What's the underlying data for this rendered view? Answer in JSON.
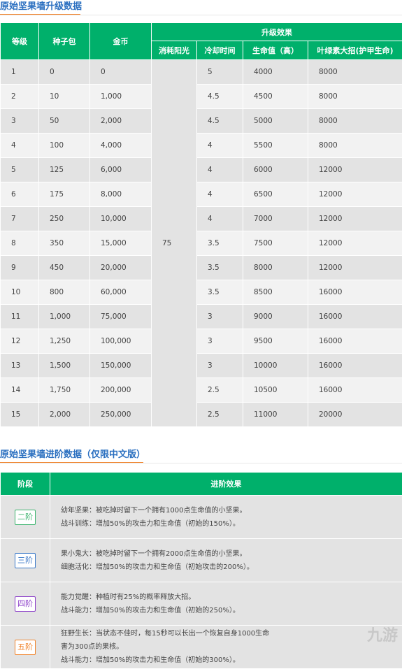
{
  "upgrade_section": {
    "title": "原始坚果墙升级数据",
    "headers": {
      "level": "等级",
      "seed_pack": "种子包",
      "gold": "金币",
      "effect_group": "升级效果",
      "sun_cost": "消耗阳光",
      "cooldown": "冷却时间",
      "health": "生命值（高）",
      "plant_food": "叶绿素大招(护甲生命)"
    },
    "sun_cost_value": "75",
    "rows": [
      {
        "level": "1",
        "seed": "0",
        "gold": "0",
        "cooldown": "5",
        "health": "4000",
        "pf": "8000"
      },
      {
        "level": "2",
        "seed": "10",
        "gold": "1,000",
        "cooldown": "4.5",
        "health": "4500",
        "pf": "8000"
      },
      {
        "level": "3",
        "seed": "50",
        "gold": "2,000",
        "cooldown": "4.5",
        "health": "5000",
        "pf": "8000"
      },
      {
        "level": "4",
        "seed": "100",
        "gold": "4,000",
        "cooldown": "4",
        "health": "5500",
        "pf": "8000"
      },
      {
        "level": "5",
        "seed": "125",
        "gold": "6,000",
        "cooldown": "4",
        "health": "6000",
        "pf": "12000"
      },
      {
        "level": "6",
        "seed": "175",
        "gold": "8,000",
        "cooldown": "4",
        "health": "6500",
        "pf": "12000"
      },
      {
        "level": "7",
        "seed": "250",
        "gold": "10,000",
        "cooldown": "4",
        "health": "7000",
        "pf": "12000"
      },
      {
        "level": "8",
        "seed": "350",
        "gold": "15,000",
        "cooldown": "3.5",
        "health": "7500",
        "pf": "12000"
      },
      {
        "level": "9",
        "seed": "450",
        "gold": "20,000",
        "cooldown": "3.5",
        "health": "8000",
        "pf": "12000"
      },
      {
        "level": "10",
        "seed": "800",
        "gold": "60,000",
        "cooldown": "3.5",
        "health": "8500",
        "pf": "16000"
      },
      {
        "level": "11",
        "seed": "1,000",
        "gold": "75,000",
        "cooldown": "3",
        "health": "9000",
        "pf": "16000"
      },
      {
        "level": "12",
        "seed": "1,250",
        "gold": "100,000",
        "cooldown": "3",
        "health": "9500",
        "pf": "16000"
      },
      {
        "level": "13",
        "seed": "1,500",
        "gold": "150,000",
        "cooldown": "3",
        "health": "10000",
        "pf": "16000"
      },
      {
        "level": "14",
        "seed": "1,750",
        "gold": "200,000",
        "cooldown": "2.5",
        "health": "10500",
        "pf": "16000"
      },
      {
        "level": "15",
        "seed": "2,000",
        "gold": "250,000",
        "cooldown": "2.5",
        "health": "11000",
        "pf": "20000"
      }
    ]
  },
  "advance_section": {
    "title": "原始坚果墙进阶数据（仅限中文版）",
    "headers": {
      "stage": "阶段",
      "effect": "进阶效果"
    },
    "rows": [
      {
        "stage": "二阶",
        "color": "#3cb46e",
        "lines": [
          "幼年坚果：被吃掉时留下一个拥有1000点生命值的小坚果。",
          "战斗训练：增加50%的攻击力和生命值（初始的150%）。"
        ]
      },
      {
        "stage": "三阶",
        "color": "#3a78c8",
        "lines": [
          "果小鬼大：被吃掉时留下一个拥有2000点生命值的小坚果。",
          "细胞活化：增加50%的攻击力和生命值（初始攻击的200%）。"
        ]
      },
      {
        "stage": "四阶",
        "color": "#8a3cc8",
        "lines": [
          "能力觉醒：种植时有25%的概率释放大招。",
          "战斗能力：增加50%的攻击力和生命值（初始的250%）。"
        ]
      },
      {
        "stage": "五阶",
        "color": "#f0832a",
        "lines": [
          "狂野生长：当状态不佳时，每15秒可以长出一个恢复自身1000生命",
          "害为300点的果核。",
          "战斗能力：增加50%的攻击力和生命值（初始的300%）。"
        ]
      }
    ]
  },
  "watermark": "九游"
}
